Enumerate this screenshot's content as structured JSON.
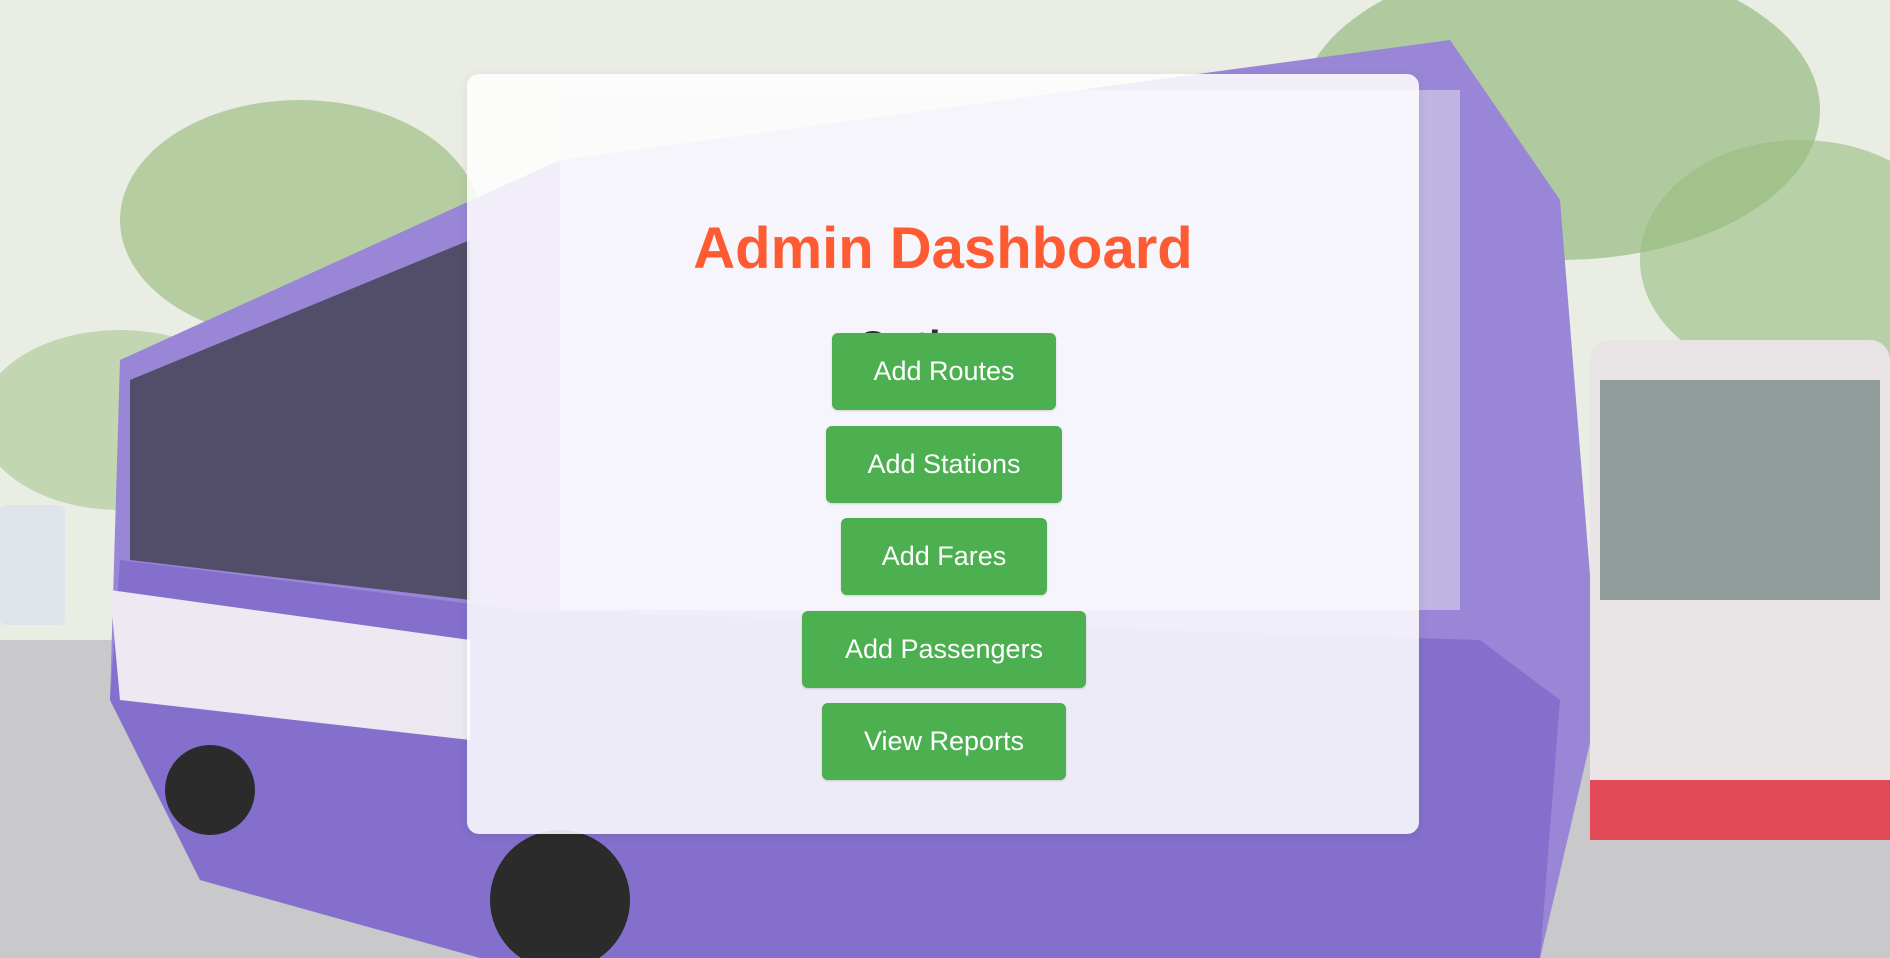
{
  "dashboard": {
    "title": "Admin Dashboard",
    "options_heading": "Options:"
  },
  "buttons": {
    "add_routes": "Add Routes",
    "add_stations": "Add Stations",
    "add_fares": "Add Fares",
    "add_passengers": "Add Passengers",
    "view_reports": "View Reports"
  },
  "colors": {
    "title": "#ff5b33",
    "heading": "#2f2f2f",
    "button_bg": "#4caf50",
    "button_text": "#ffffff",
    "panel_bg": "rgba(255,255,255,0.86)"
  }
}
